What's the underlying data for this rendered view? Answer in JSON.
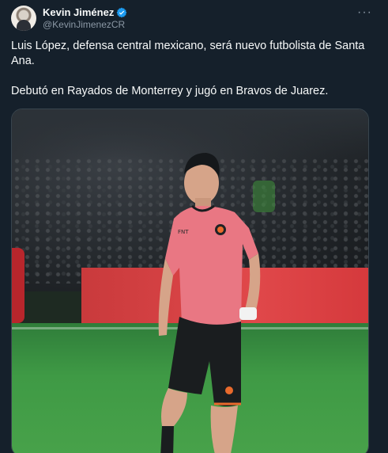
{
  "author": {
    "name": "Kevin Jiménez",
    "handle": "@KevinJimenezCR",
    "verified_color": "#1d9bf0"
  },
  "tweet": {
    "paragraphs": [
      "Luis López, defensa central mexicano, será nuevo futbolista de Santa Ana.",
      "Debutó en Rayados de Monterrey y jugó en Bravos de Juarez."
    ]
  },
  "media": {
    "description_icon": "photo",
    "banner_color": "#e0484a",
    "jersey_color": "#e97783",
    "shorts_color": "#1a1d1f"
  },
  "actions": {
    "more_label": "···"
  }
}
